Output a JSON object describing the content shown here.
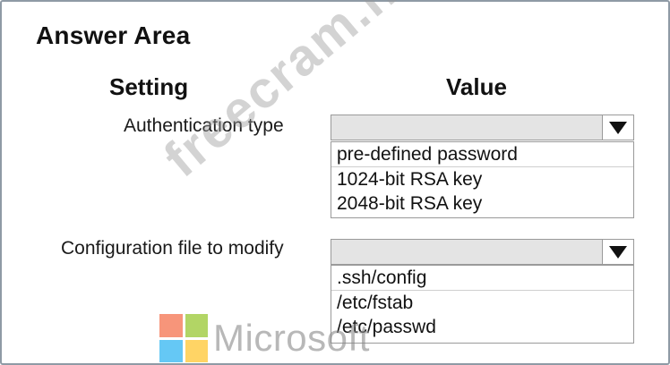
{
  "title": "Answer Area",
  "columns": {
    "setting": "Setting",
    "value": "Value"
  },
  "settings": [
    {
      "label": "Authentication type",
      "selected": "",
      "options": [
        "pre-defined password",
        "1024-bit RSA key",
        "2048-bit RSA key"
      ]
    },
    {
      "label": "Configuration file to modify",
      "selected": "",
      "options": [
        ".ssh/config",
        "/etc/fstab",
        "/etc/passwd"
      ]
    }
  ],
  "icons": {
    "dropdown_arrow": "triangle-down-icon"
  },
  "watermark": "freecram.net",
  "logo": {
    "text": "Microsoft",
    "colors": [
      "#f25022",
      "#7fba00",
      "#00a4ef",
      "#ffb900"
    ]
  }
}
